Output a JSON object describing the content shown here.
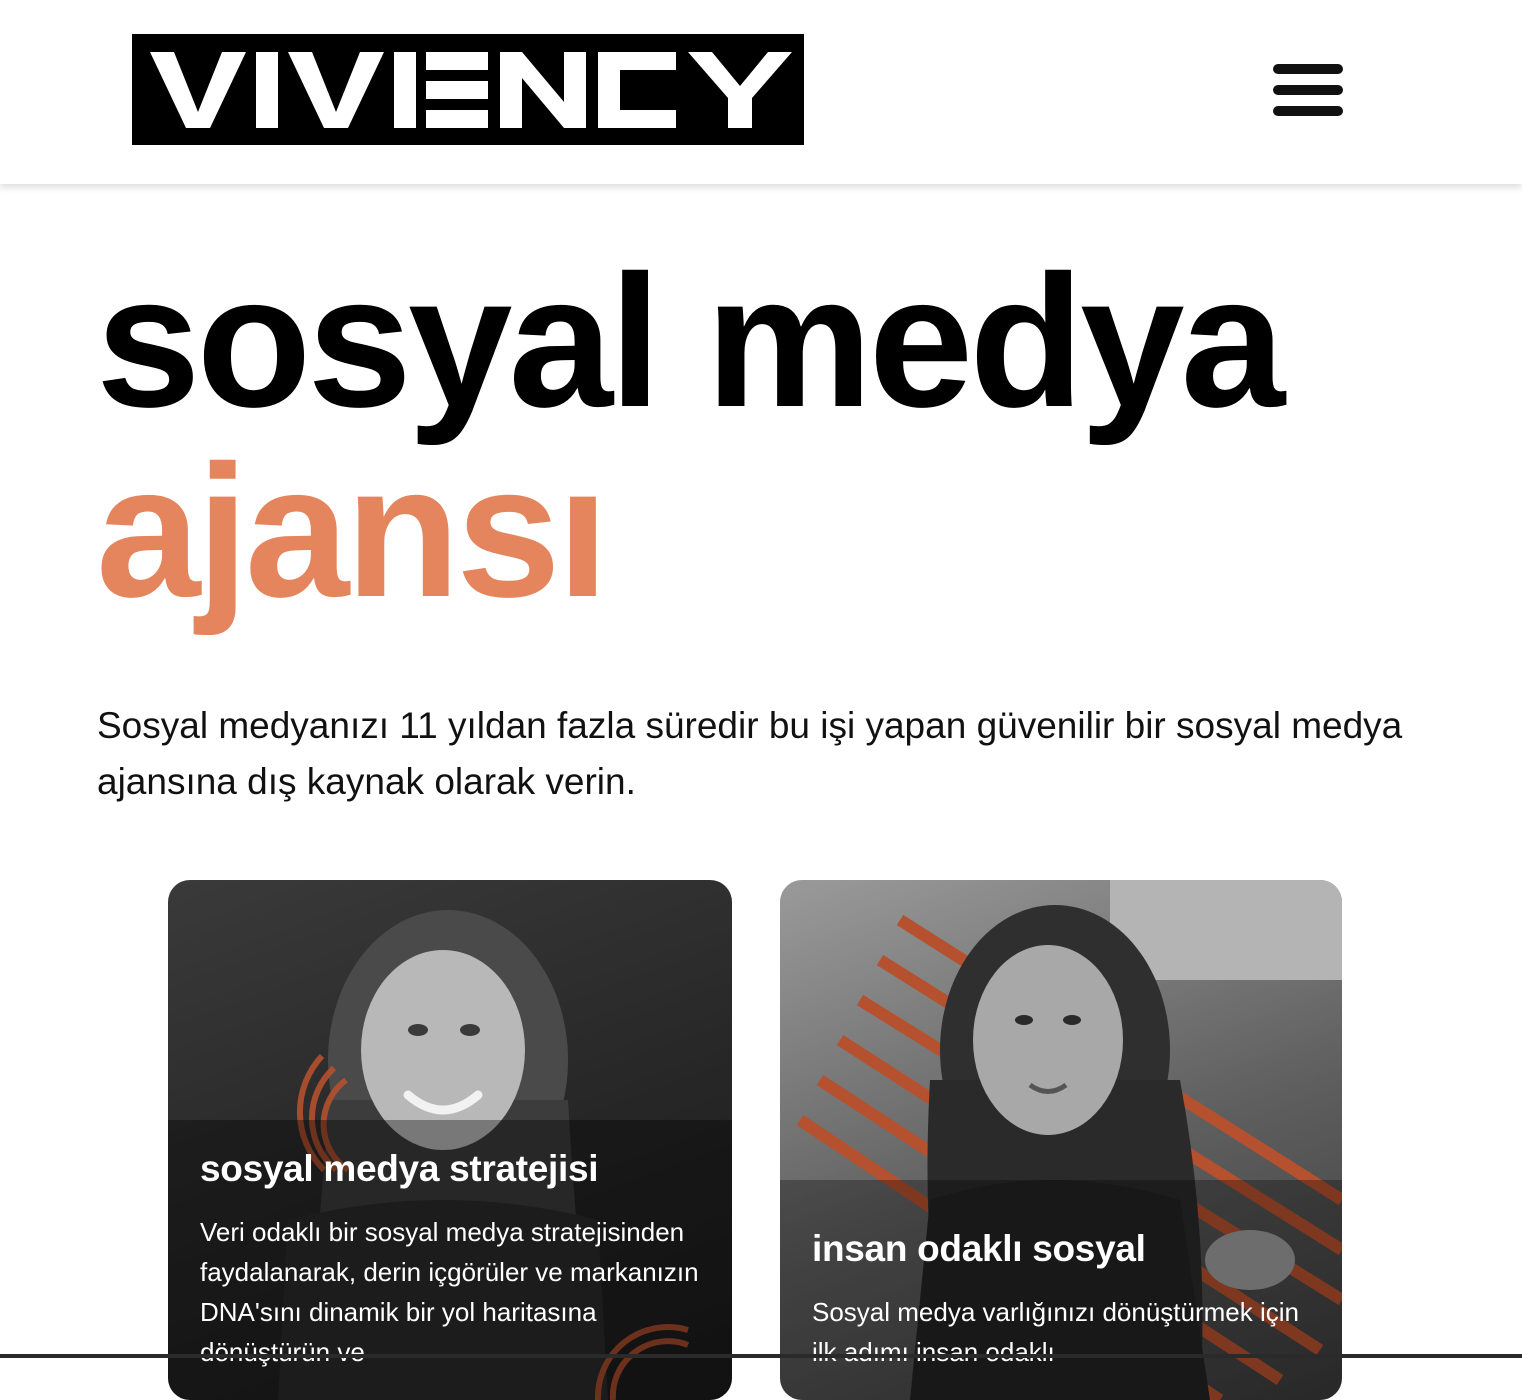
{
  "brand": {
    "logo_text": "VIVIENCY"
  },
  "header": {
    "menu_icon": "hamburger-menu-icon"
  },
  "hero": {
    "title_line1": "sosyal medya",
    "title_line2": "ajansı",
    "description": "Sosyal medyanızı 11 yıldan fazla süredir bu işi yapan güvenilir bir sosyal medya ajansına dış kaynak olarak verin."
  },
  "cards": [
    {
      "title": "sosyal medya stratejisi",
      "text": "Veri odaklı bir sosyal medya stratejisinden faydalanarak, derin içgörüler ve markanızın DNA'sını dinamik bir yol haritasına dönüştürün ve"
    },
    {
      "title": "insan odaklı sosyal",
      "text": "Sosyal medya varlığınızı dönüştürmek için ilk adımı insan odaklı"
    }
  ],
  "colors": {
    "accent": "#E4855E",
    "accent_dark": "#B5512E",
    "text": "#111111",
    "background": "#FFFFFF"
  }
}
